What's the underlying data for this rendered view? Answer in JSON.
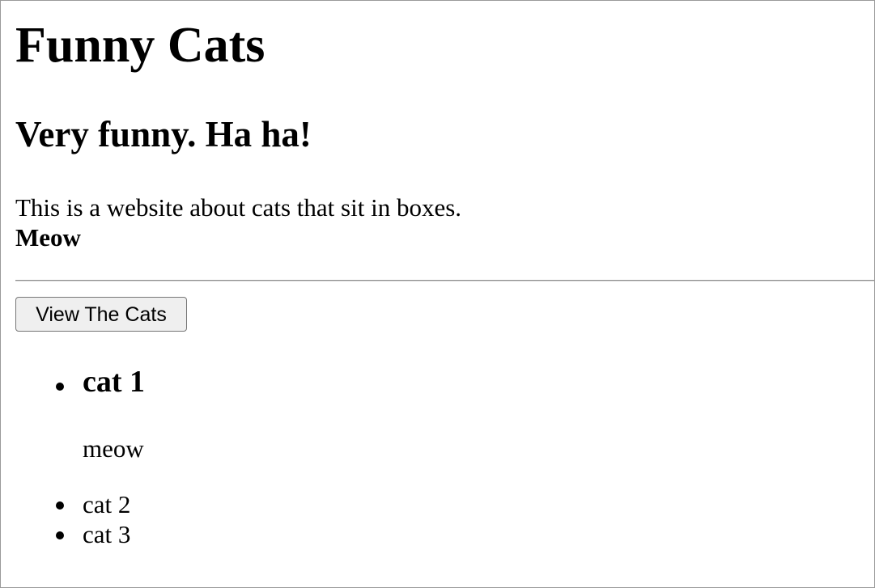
{
  "header": {
    "title": "Funny Cats",
    "subtitle": "Very funny. Ha ha!"
  },
  "intro": {
    "text": "This is a website about cats that sit in boxes.",
    "emphasis": "Meow"
  },
  "actions": {
    "view_label": "View The Cats"
  },
  "cats": [
    {
      "name": "cat 1",
      "description": "meow"
    },
    {
      "name": "cat 2"
    },
    {
      "name": "cat 3"
    }
  ]
}
